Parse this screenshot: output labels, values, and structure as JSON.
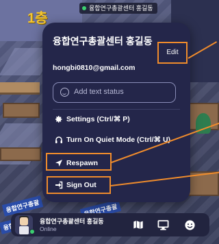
{
  "scene": {
    "top_label": "융합연구총괄센터 홍길동",
    "logo_text": "1층",
    "banner_text": "융합연구총괄"
  },
  "popup": {
    "name": "융합연구총괄센터 홍길동",
    "edit_label": "Edit",
    "email": "hongbi0810@gmail.com",
    "status_placeholder": "Add text status",
    "menu": {
      "settings": "Settings (Ctrl/⌘ P)",
      "quiet_mode": "Turn On Quiet Mode (Ctrl/⌘ U)",
      "respawn": "Respawn",
      "sign_out": "Sign Out"
    }
  },
  "bottom_bar": {
    "name": "융합연구총괄센터 홍길동",
    "status": "Online"
  },
  "colors": {
    "popup_bg": "#24264a",
    "highlight": "#f08c2c",
    "online": "#3cd070"
  },
  "icons": [
    "smiley-icon",
    "gear-icon",
    "headphones-icon",
    "location-arrow-icon",
    "sign-out-icon",
    "map-icon",
    "monitor-icon",
    "emoji-icon"
  ]
}
